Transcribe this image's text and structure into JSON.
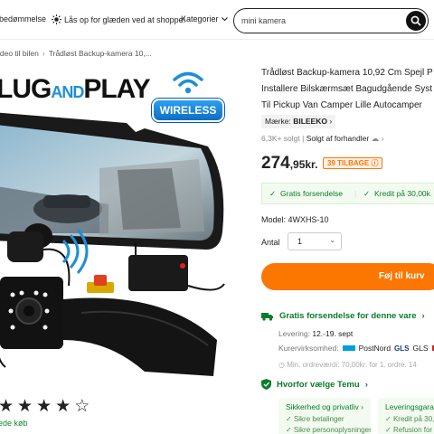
{
  "topbar": {
    "reviews": "bedømmelse",
    "promo": "Lås op for glæden ved at shoppe!",
    "categories": "Kategorier",
    "search_value": "mini kamera"
  },
  "breadcrumb": [
    "ideo til bilen",
    "Trådløst Backup-kamera 10,..."
  ],
  "hero": {
    "plug_pre": "LUG",
    "plug_and": "AND",
    "plug_post": "PLAY",
    "wireless": "WIRELESS"
  },
  "rating": {
    "stars": 4.5,
    "sold_text": "ede køb"
  },
  "product": {
    "title_lines": [
      "Trådløst Backup-kamera 10,92 Cm Spejl P",
      "Installere Bilskærmsæt Bagudgående Syst",
      "Til Pickup Van Camper Lille Autocamper"
    ],
    "brand_label": "Mærke:",
    "brand": "BILEEKO",
    "sold": "6,3K+ solgt",
    "seller": "Solgt af forhandler",
    "price_main": "274",
    "price_dec": ",95kr.",
    "discount": "39 TILBAGE",
    "ship_free": "Gratis forsendelse",
    "credit": "Kredit på 30,00k",
    "model": "Model: 4WXHS-10",
    "qty_label": "Antal",
    "qty_value": "1",
    "cart_button": "Føj til kurv"
  },
  "shipping": {
    "title": "Gratis forsendelse for denne vare",
    "delivery_label": "Levering:",
    "delivery_value": "12.-19. sept",
    "couriers_label": "Kurervirksomhed:",
    "courier1": "PostNord",
    "courier2": "GLS",
    "courier3": "GLS",
    "min_order": "Min. ordreværdi: 70,00kr. for 1. ordre. 14"
  },
  "why": {
    "title": "Hvorfor vælge Temu",
    "card1_title": "Sikkerhed og privatliv",
    "card1_line": "Sikre betalinger",
    "card1_line2": "Sikre personoplysninger",
    "card2_title": "Leveringsgara",
    "card2_line": "Kredit på 30,0",
    "card2_line2": "Refusion for"
  },
  "colors": {
    "accent": "#fb7701",
    "green": "#0a7d2a"
  }
}
